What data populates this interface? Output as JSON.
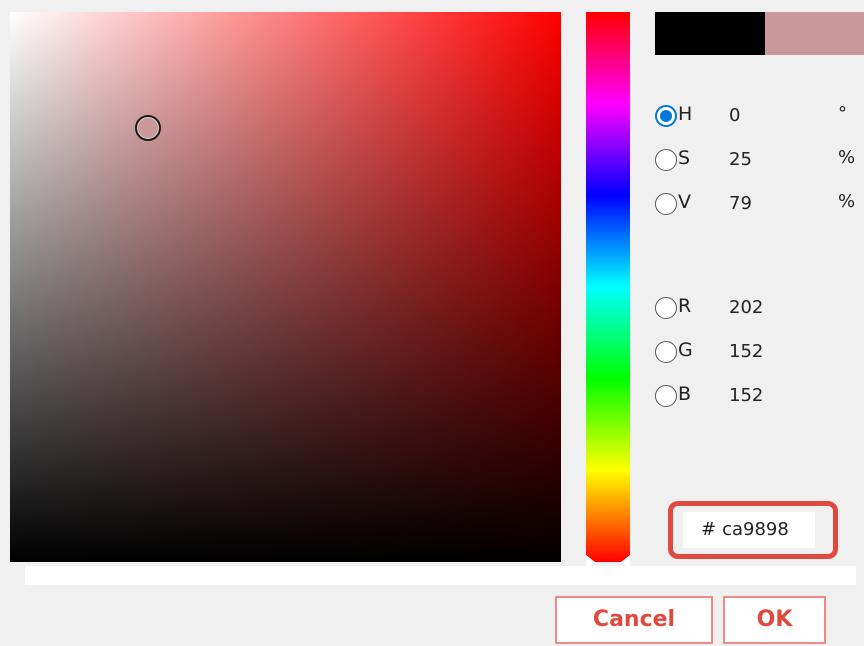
{
  "colors": {
    "current": "#000000",
    "new": "#ca9898",
    "accent_border": "#e0493e"
  },
  "picker": {
    "cursor": {
      "saturation": 0.25,
      "value": 0.79
    }
  },
  "hue_marker_value": 0,
  "hsv": [
    {
      "id": "h",
      "label": "H",
      "value": "0",
      "unit": "°",
      "checked": true
    },
    {
      "id": "s",
      "label": "S",
      "value": "25",
      "unit": "%",
      "checked": false
    },
    {
      "id": "v",
      "label": "V",
      "value": "79",
      "unit": "%",
      "checked": false
    }
  ],
  "rgb": [
    {
      "id": "r",
      "label": "R",
      "value": "202"
    },
    {
      "id": "g",
      "label": "G",
      "value": "152"
    },
    {
      "id": "b",
      "label": "B",
      "value": "152"
    }
  ],
  "hex": {
    "prefix": "#",
    "value": "ca9898"
  },
  "buttons": {
    "cancel": "Cancel",
    "ok": "OK"
  }
}
